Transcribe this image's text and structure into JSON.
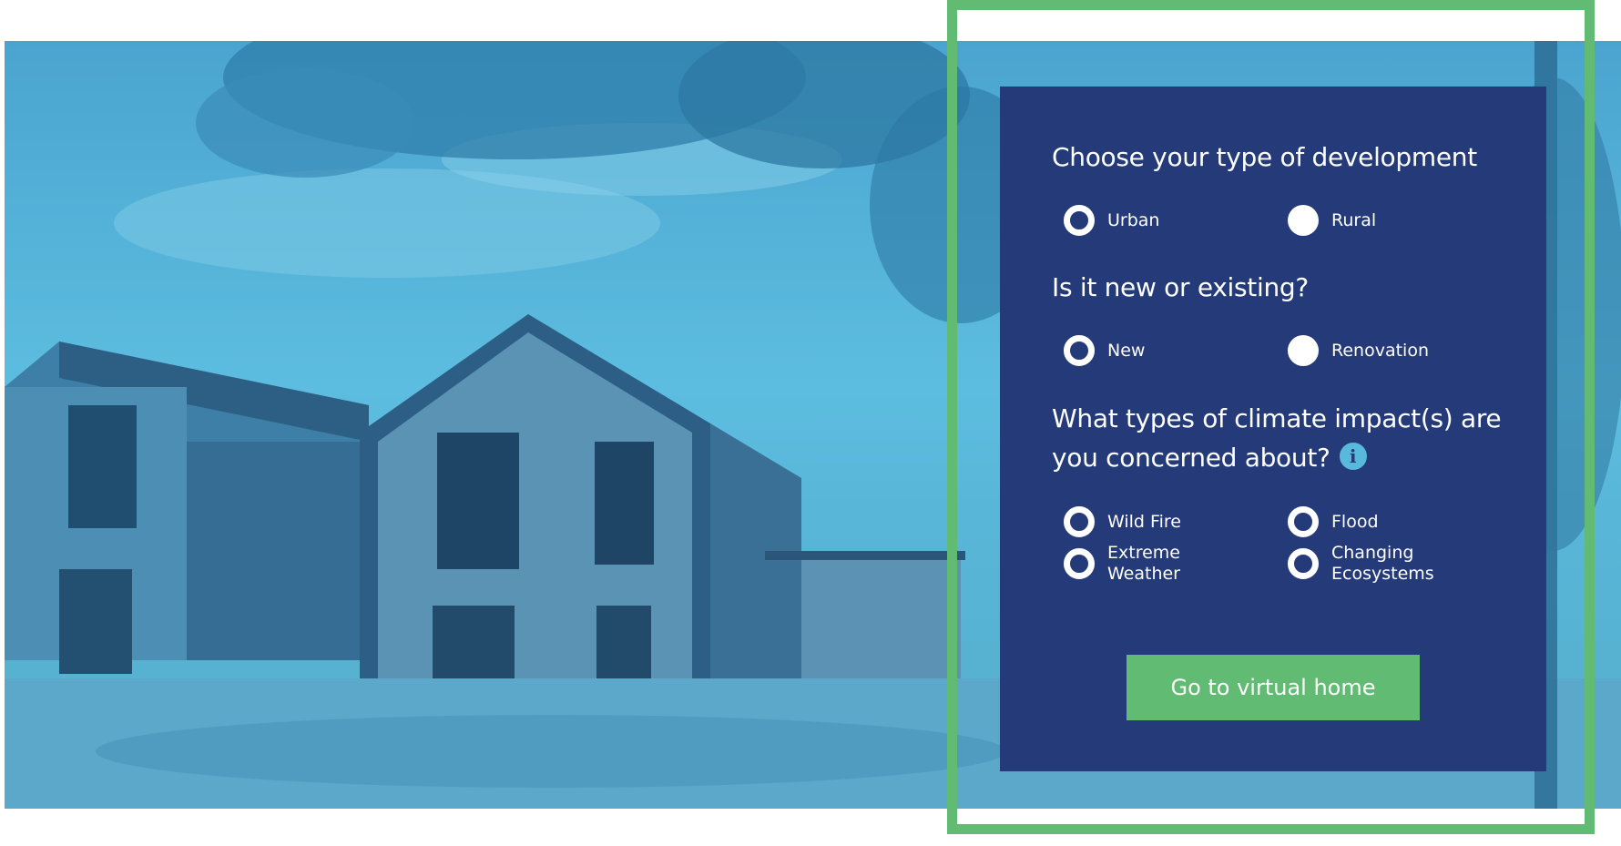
{
  "colors": {
    "panel_bg": "#253b79",
    "frame": "#62bb73",
    "button_bg": "#62bb73",
    "info_icon": "#59b9dc",
    "hero_tint": "#5dbde0"
  },
  "hero": {
    "image": "house-photo"
  },
  "form": {
    "development": {
      "question": "Choose your type of development",
      "options": [
        {
          "label": "Urban",
          "selected": false
        },
        {
          "label": "Rural",
          "selected": true
        }
      ]
    },
    "status": {
      "question": "Is it new or existing?",
      "options": [
        {
          "label": "New",
          "selected": false
        },
        {
          "label": "Renovation",
          "selected": true
        }
      ]
    },
    "impacts": {
      "question_line1": "What types of climate impact(s) are",
      "question_line2": "you concerned about?",
      "info_icon": "i",
      "options": [
        {
          "label": "Wild Fire",
          "selected": false
        },
        {
          "label": "Flood",
          "selected": false
        },
        {
          "label": "Extreme\nWeather",
          "selected": false
        },
        {
          "label": "Changing\nEcosystems",
          "selected": false
        }
      ]
    },
    "submit_label": "Go to virtual home"
  }
}
